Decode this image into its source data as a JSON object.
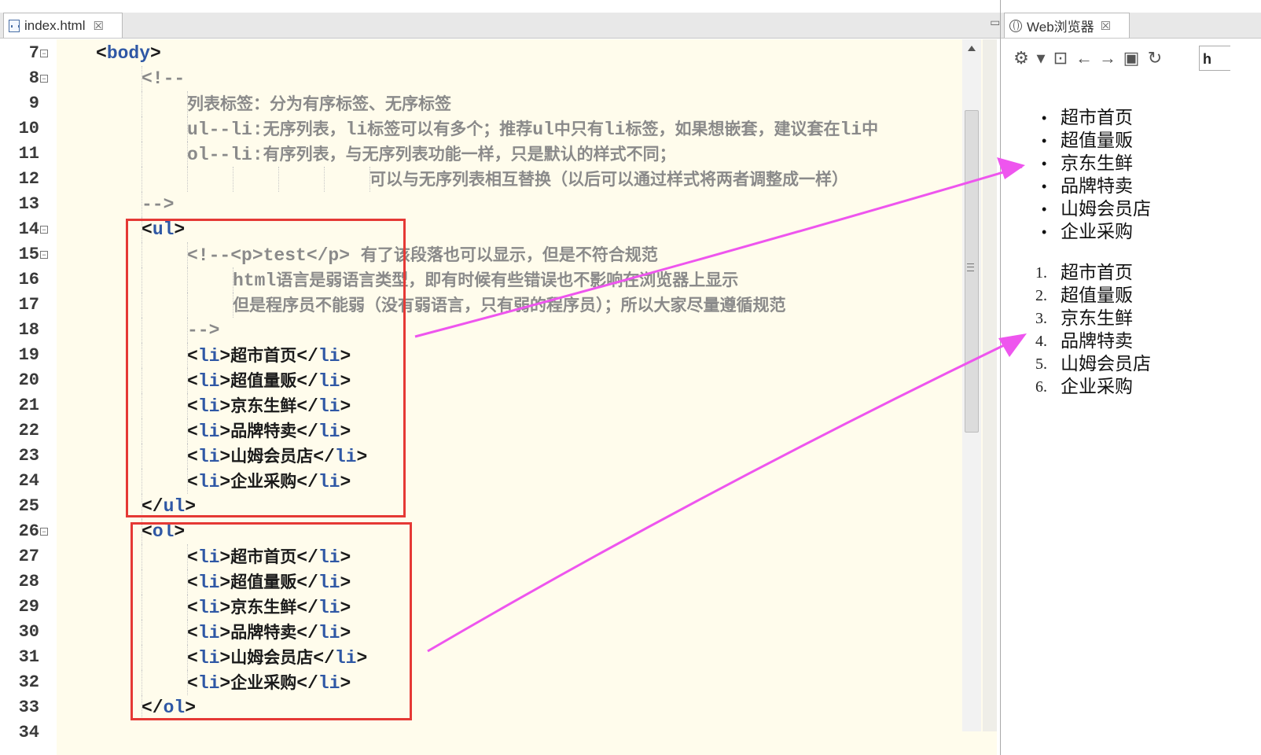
{
  "editor": {
    "tab_title": "index.html",
    "tab_close": "☒",
    "window_buttons": [
      "▭",
      "◻"
    ]
  },
  "code_lines": [
    {
      "num": "7",
      "fold": "⊟",
      "indent": 2,
      "parts": [
        {
          "t": "<",
          "c": "tag"
        },
        {
          "t": "body",
          "c": "name"
        },
        {
          "t": ">",
          "c": "tag"
        }
      ]
    },
    {
      "num": "8",
      "fold": "⊟",
      "indent": 3,
      "parts": [
        {
          "t": "<!--",
          "c": "cmt"
        }
      ]
    },
    {
      "num": "9",
      "fold": "",
      "indent": 4,
      "parts": [
        {
          "t": "列表标签：分为有序标签、无序标签",
          "c": "cmt cjk"
        }
      ]
    },
    {
      "num": "10",
      "fold": "",
      "indent": 4,
      "parts": [
        {
          "t": "ul--li:",
          "c": "cmt"
        },
        {
          "t": "无序列表，",
          "c": "cmt cjk"
        },
        {
          "t": "li",
          "c": "cmt"
        },
        {
          "t": "标签可以有多个；推荐",
          "c": "cmt cjk"
        },
        {
          "t": "ul",
          "c": "cmt"
        },
        {
          "t": "中只有",
          "c": "cmt cjk"
        },
        {
          "t": "li",
          "c": "cmt"
        },
        {
          "t": "标签，如果想嵌套，建议套在",
          "c": "cmt cjk"
        },
        {
          "t": "li",
          "c": "cmt"
        },
        {
          "t": "中",
          "c": "cmt cjk"
        }
      ]
    },
    {
      "num": "11",
      "fold": "",
      "indent": 4,
      "parts": [
        {
          "t": "ol--li:",
          "c": "cmt"
        },
        {
          "t": "有序列表，与无序列表功能一样，只是默认的样式不同；",
          "c": "cmt cjk"
        }
      ]
    },
    {
      "num": "12",
      "fold": "",
      "indent": 8,
      "parts": [
        {
          "t": "可以与无序列表相互替换（以后可以通过样式将两者调整成一样）",
          "c": "cmt cjk"
        }
      ]
    },
    {
      "num": "13",
      "fold": "",
      "indent": 3,
      "parts": [
        {
          "t": "-->",
          "c": "cmt"
        }
      ]
    },
    {
      "num": "14",
      "fold": "⊟",
      "indent": 3,
      "parts": [
        {
          "t": "<",
          "c": "tag"
        },
        {
          "t": "ul",
          "c": "name"
        },
        {
          "t": ">",
          "c": "tag"
        }
      ]
    },
    {
      "num": "15",
      "fold": "⊟",
      "indent": 4,
      "parts": [
        {
          "t": "<!--<p>test</p> ",
          "c": "cmt"
        },
        {
          "t": "有了该段落也可以显示，但是不符合规范",
          "c": "cmt cjk"
        }
      ]
    },
    {
      "num": "16",
      "fold": "",
      "indent": 5,
      "parts": [
        {
          "t": "html",
          "c": "cmt"
        },
        {
          "t": "语言是弱语言类型，即有时候有些错误也不影响在浏览器上显示",
          "c": "cmt cjk"
        }
      ]
    },
    {
      "num": "17",
      "fold": "",
      "indent": 5,
      "parts": [
        {
          "t": "但是程序员不能弱（没有弱语言，只有弱的程序员）；所以大家尽量遵循规范",
          "c": "cmt cjk"
        }
      ]
    },
    {
      "num": "18",
      "fold": "",
      "indent": 4,
      "parts": [
        {
          "t": "-->",
          "c": "cmt"
        }
      ]
    },
    {
      "num": "19",
      "fold": "",
      "indent": 4,
      "parts": [
        {
          "t": "<",
          "c": "tag"
        },
        {
          "t": "li",
          "c": "name"
        },
        {
          "t": ">",
          "c": "tag"
        },
        {
          "t": "超市首页",
          "c": "text cjk"
        },
        {
          "t": "</",
          "c": "tag"
        },
        {
          "t": "li",
          "c": "name"
        },
        {
          "t": ">",
          "c": "tag"
        }
      ]
    },
    {
      "num": "20",
      "fold": "",
      "indent": 4,
      "parts": [
        {
          "t": "<",
          "c": "tag"
        },
        {
          "t": "li",
          "c": "name"
        },
        {
          "t": ">",
          "c": "tag"
        },
        {
          "t": "超值量贩",
          "c": "text cjk"
        },
        {
          "t": "</",
          "c": "tag"
        },
        {
          "t": "li",
          "c": "name"
        },
        {
          "t": ">",
          "c": "tag"
        }
      ]
    },
    {
      "num": "21",
      "fold": "",
      "indent": 4,
      "parts": [
        {
          "t": "<",
          "c": "tag"
        },
        {
          "t": "li",
          "c": "name"
        },
        {
          "t": ">",
          "c": "tag"
        },
        {
          "t": "京东生鲜",
          "c": "text cjk"
        },
        {
          "t": "</",
          "c": "tag"
        },
        {
          "t": "li",
          "c": "name"
        },
        {
          "t": ">",
          "c": "tag"
        }
      ]
    },
    {
      "num": "22",
      "fold": "",
      "indent": 4,
      "parts": [
        {
          "t": "<",
          "c": "tag"
        },
        {
          "t": "li",
          "c": "name"
        },
        {
          "t": ">",
          "c": "tag"
        },
        {
          "t": "品牌特卖",
          "c": "text cjk"
        },
        {
          "t": "</",
          "c": "tag"
        },
        {
          "t": "li",
          "c": "name"
        },
        {
          "t": ">",
          "c": "tag"
        }
      ]
    },
    {
      "num": "23",
      "fold": "",
      "indent": 4,
      "parts": [
        {
          "t": "<",
          "c": "tag"
        },
        {
          "t": "li",
          "c": "name"
        },
        {
          "t": ">",
          "c": "tag"
        },
        {
          "t": "山姆会员店",
          "c": "text cjk"
        },
        {
          "t": "</",
          "c": "tag"
        },
        {
          "t": "li",
          "c": "name"
        },
        {
          "t": ">",
          "c": "tag"
        }
      ]
    },
    {
      "num": "24",
      "fold": "",
      "indent": 4,
      "parts": [
        {
          "t": "<",
          "c": "tag"
        },
        {
          "t": "li",
          "c": "name"
        },
        {
          "t": ">",
          "c": "tag"
        },
        {
          "t": "企业采购",
          "c": "text cjk"
        },
        {
          "t": "</",
          "c": "tag"
        },
        {
          "t": "li",
          "c": "name"
        },
        {
          "t": ">",
          "c": "tag"
        }
      ]
    },
    {
      "num": "25",
      "fold": "",
      "indent": 3,
      "parts": [
        {
          "t": "</",
          "c": "tag"
        },
        {
          "t": "ul",
          "c": "name"
        },
        {
          "t": ">",
          "c": "tag"
        }
      ]
    },
    {
      "num": "26",
      "fold": "⊟",
      "indent": 3,
      "parts": [
        {
          "t": "<",
          "c": "tag"
        },
        {
          "t": "ol",
          "c": "name"
        },
        {
          "t": ">",
          "c": "tag"
        }
      ]
    },
    {
      "num": "27",
      "fold": "",
      "indent": 4,
      "parts": [
        {
          "t": "<",
          "c": "tag"
        },
        {
          "t": "li",
          "c": "name"
        },
        {
          "t": ">",
          "c": "tag"
        },
        {
          "t": "超市首页",
          "c": "text cjk"
        },
        {
          "t": "</",
          "c": "tag"
        },
        {
          "t": "li",
          "c": "name"
        },
        {
          "t": ">",
          "c": "tag"
        }
      ]
    },
    {
      "num": "28",
      "fold": "",
      "indent": 4,
      "parts": [
        {
          "t": "<",
          "c": "tag"
        },
        {
          "t": "li",
          "c": "name"
        },
        {
          "t": ">",
          "c": "tag"
        },
        {
          "t": "超值量贩",
          "c": "text cjk"
        },
        {
          "t": "</",
          "c": "tag"
        },
        {
          "t": "li",
          "c": "name"
        },
        {
          "t": ">",
          "c": "tag"
        }
      ]
    },
    {
      "num": "29",
      "fold": "",
      "indent": 4,
      "parts": [
        {
          "t": "<",
          "c": "tag"
        },
        {
          "t": "li",
          "c": "name"
        },
        {
          "t": ">",
          "c": "tag"
        },
        {
          "t": "京东生鲜",
          "c": "text cjk"
        },
        {
          "t": "</",
          "c": "tag"
        },
        {
          "t": "li",
          "c": "name"
        },
        {
          "t": ">",
          "c": "tag"
        }
      ]
    },
    {
      "num": "30",
      "fold": "",
      "indent": 4,
      "parts": [
        {
          "t": "<",
          "c": "tag"
        },
        {
          "t": "li",
          "c": "name"
        },
        {
          "t": ">",
          "c": "tag"
        },
        {
          "t": "品牌特卖",
          "c": "text cjk"
        },
        {
          "t": "</",
          "c": "tag"
        },
        {
          "t": "li",
          "c": "name"
        },
        {
          "t": ">",
          "c": "tag"
        }
      ]
    },
    {
      "num": "31",
      "fold": "",
      "indent": 4,
      "parts": [
        {
          "t": "<",
          "c": "tag"
        },
        {
          "t": "li",
          "c": "name"
        },
        {
          "t": ">",
          "c": "tag"
        },
        {
          "t": "山姆会员店",
          "c": "text cjk"
        },
        {
          "t": "</",
          "c": "tag"
        },
        {
          "t": "li",
          "c": "name"
        },
        {
          "t": ">",
          "c": "tag"
        }
      ]
    },
    {
      "num": "32",
      "fold": "",
      "indent": 4,
      "parts": [
        {
          "t": "<",
          "c": "tag"
        },
        {
          "t": "li",
          "c": "name"
        },
        {
          "t": ">",
          "c": "tag"
        },
        {
          "t": "企业采购",
          "c": "text cjk"
        },
        {
          "t": "</",
          "c": "tag"
        },
        {
          "t": "li",
          "c": "name"
        },
        {
          "t": ">",
          "c": "tag"
        }
      ]
    },
    {
      "num": "33",
      "fold": "",
      "indent": 3,
      "parts": [
        {
          "t": "</",
          "c": "tag"
        },
        {
          "t": "ol",
          "c": "name"
        },
        {
          "t": ">",
          "c": "tag"
        }
      ]
    },
    {
      "num": "34",
      "fold": "",
      "indent": 2,
      "parts": []
    }
  ],
  "browser": {
    "tab_title": "Web浏览器",
    "tab_close": "☒",
    "toolbar_icons": [
      {
        "name": "settings-gear-icon",
        "glyph": "⚙"
      },
      {
        "name": "dropdown-caret-icon",
        "glyph": "▾"
      },
      {
        "name": "console-icon",
        "glyph": "⊡"
      },
      {
        "name": "back-arrow-icon",
        "glyph": "←"
      },
      {
        "name": "forward-arrow-icon",
        "glyph": "→"
      },
      {
        "name": "stop-icon",
        "glyph": "▣"
      },
      {
        "name": "refresh-icon",
        "glyph": "↻"
      }
    ],
    "url_value": "h",
    "unordered_list": [
      "超市首页",
      "超值量贩",
      "京东生鲜",
      "品牌特卖",
      "山姆会员店",
      "企业采购"
    ],
    "ordered_list": [
      "超市首页",
      "超值量贩",
      "京东生鲜",
      "品牌特卖",
      "山姆会员店",
      "企业采购"
    ],
    "bullet": "•"
  },
  "colors": {
    "highlight_box": "#e53935",
    "annotation_arrow": "#ee55ee",
    "tag_name": "#2f58a5",
    "comment": "#8a8a8a",
    "editor_bg": "#fffcec"
  }
}
